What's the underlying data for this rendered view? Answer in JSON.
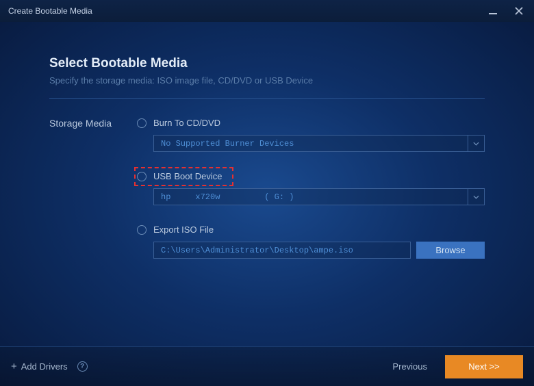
{
  "titlebar": {
    "title": "Create Bootable Media"
  },
  "header": {
    "title": "Select Bootable Media",
    "subtitle": "Specify the storage media: ISO image file, CD/DVD or USB Device"
  },
  "left_label": "Storage Media",
  "options": {
    "cddvd": {
      "label": "Burn To CD/DVD",
      "select_text": "No Supported Burner Devices"
    },
    "usb": {
      "label": "USB Boot Device",
      "select_text": "hp     x720w         ( G: )"
    },
    "iso": {
      "label": "Export ISO File",
      "path": "C:\\Users\\Administrator\\Desktop\\ampe.iso",
      "browse_label": "Browse"
    }
  },
  "footer": {
    "add_drivers": "Add Drivers",
    "previous": "Previous",
    "next": "Next >>"
  }
}
